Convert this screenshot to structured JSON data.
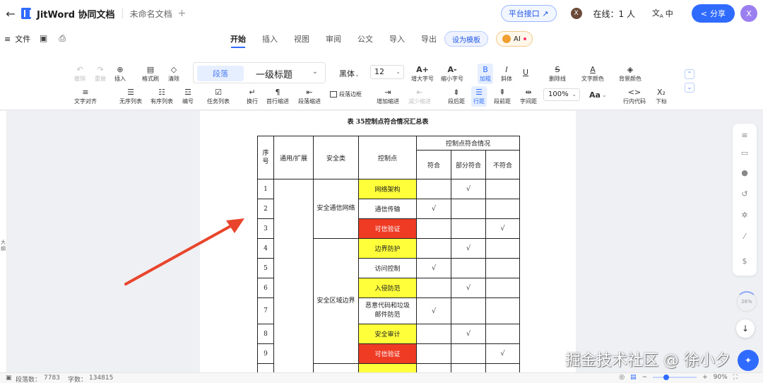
{
  "header": {
    "back_icon": "arrow-left-icon",
    "brand": "JitWord 协同文档",
    "doc_name": "未命名文档",
    "new_tab": "+",
    "api_button": "平台接口 ↗",
    "user_avatar": "X",
    "online": "在线：1 人",
    "lang": "中",
    "share": "分享",
    "profile_avatar": "X"
  },
  "menu": {
    "file": "文件",
    "tabs": [
      "开始",
      "插入",
      "视图",
      "审阅",
      "公文",
      "导入",
      "导出"
    ],
    "active_tab": "开始",
    "template_button": "设为模板",
    "ai_button": "AI"
  },
  "toolbar": {
    "undo": "撤销",
    "redo": "重做",
    "insert": "插入",
    "format_painter": "格式刷",
    "clear": "清除",
    "style_paragraph": "段落",
    "style_heading": "一级标题",
    "font": "黑体",
    "size": "12",
    "grow_font": "增大字号",
    "shrink_font": "缩小字号",
    "bold": "加粗",
    "italic": "斜体",
    "underline": "U",
    "strikethrough": "删除线",
    "font_color": "文字颜色",
    "bg_color": "背景颜色",
    "text_align": "文字对齐",
    "unordered_list": "无序列表",
    "ordered_list": "有序列表",
    "numbering": "编号",
    "task_list": "任务列表",
    "line_break": "换行",
    "first_indent": "首行缩进",
    "para_indent": "段落缩进",
    "para_border": "段落边框",
    "increase_indent": "增加缩进",
    "decrease_indent": "减少缩进",
    "space_after": "段后距",
    "line_spacing": "行距",
    "space_before": "段前距",
    "letter_spacing": "字间距",
    "zoom": "100%",
    "case": "Aa",
    "inline_code": "行内代码",
    "subscript": "下标"
  },
  "left_strip_text": "大纲",
  "document": {
    "caption": "表 35控制点符合情况汇总表",
    "headers": {
      "seq": "序号",
      "scope": "通用/扩展",
      "category": "安全类",
      "control": "控制点",
      "compliance": "控制点符合情况",
      "full": "符合",
      "partial": "部分符合",
      "none": "不符合"
    },
    "check_mark": "√",
    "groups": [
      {
        "name": "安全通信网络"
      },
      {
        "name": "安全区域边界"
      }
    ],
    "rows": [
      {
        "no": "1",
        "control": "网络架构",
        "color": "yellow",
        "status": "partial"
      },
      {
        "no": "2",
        "control": "通信传输",
        "color": "white",
        "status": "full"
      },
      {
        "no": "3",
        "control": "可信验证",
        "color": "red",
        "status": "none"
      },
      {
        "no": "4",
        "control": "边界防护",
        "color": "yellow",
        "status": "partial"
      },
      {
        "no": "5",
        "control": "访问控制",
        "color": "white",
        "status": "full"
      },
      {
        "no": "6",
        "control": "入侵防范",
        "color": "yellow",
        "status": "partial"
      },
      {
        "no": "7",
        "control": "恶意代码和垃圾邮件防范",
        "color": "white",
        "status": "full"
      },
      {
        "no": "8",
        "control": "安全审计",
        "color": "yellow",
        "status": "partial"
      },
      {
        "no": "9",
        "control": "可信验证",
        "color": "red",
        "status": "none"
      }
    ]
  },
  "side_progress": "26%",
  "watermark": "掘金技术社区 @ 徐小夕",
  "status": {
    "paragraphs_label": "段落数：",
    "paragraphs": "7783",
    "chars_label": "字数：",
    "chars": "134815",
    "zoom": "90%",
    "zoom_fraction": 0.3
  },
  "colors": {
    "accent": "#2f6bff",
    "highlight_yellow": "#ffff3a",
    "highlight_red": "#ef3a24",
    "arrow": "#e8452c"
  }
}
